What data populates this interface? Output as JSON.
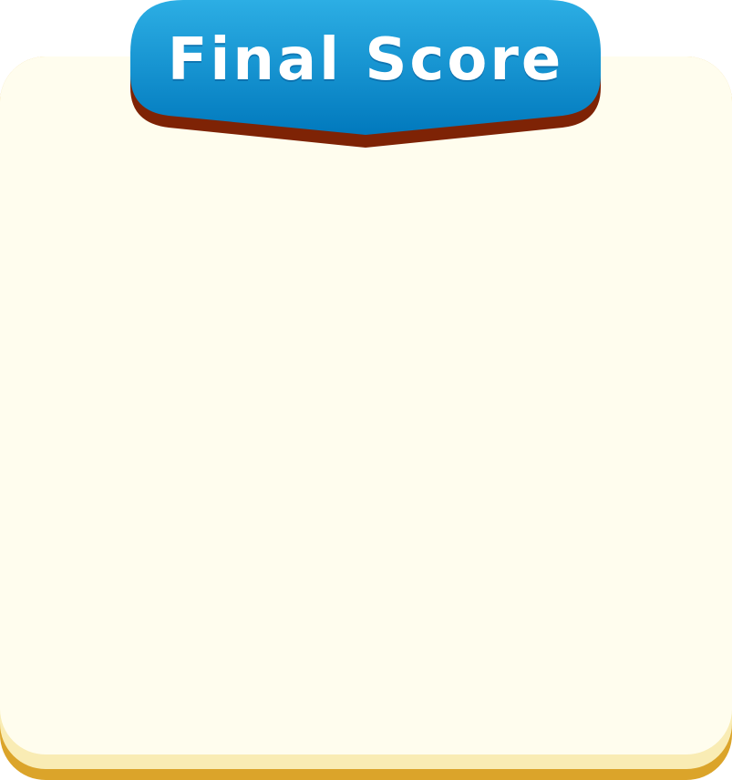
{
  "banner": {
    "title": "Final Score"
  },
  "colors": {
    "panel_face": "#FFFDEE",
    "panel_edge_light": "#F9ECB4",
    "panel_edge_dark": "#DBA42A",
    "banner_top": "#2CAEE4",
    "banner_bottom": "#0179BD",
    "banner_shadow": "#7E2305",
    "title_text": "#FFFFFF"
  }
}
